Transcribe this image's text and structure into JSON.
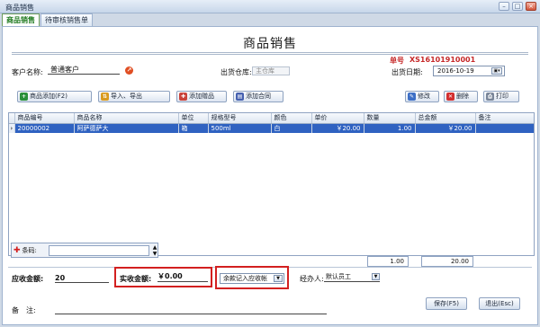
{
  "window": {
    "title": "商品销售",
    "buttons": {
      "minimize": "–",
      "maximize": "□",
      "close": "×"
    }
  },
  "tabs": [
    {
      "label": "商品销售",
      "active": true
    },
    {
      "label": "待审核销售单",
      "active": false
    }
  ],
  "form": {
    "title": "商品销售",
    "order_no_label": "单号",
    "order_no": "XS16101910001",
    "customer_label": "客户名称:",
    "customer_value": "普通客户",
    "warehouse_label": "出货仓库:",
    "warehouse_value": "主仓库",
    "date_label": "出货日期:",
    "date_value": "2016-10-19"
  },
  "toolbar": {
    "add_goods": "商品添加(F2)",
    "import_export": "导入、导出",
    "add_gift": "添加赠品",
    "add_contract": "添加合同",
    "edit": "修改",
    "delete": "删除",
    "print": "打印"
  },
  "grid": {
    "columns": [
      "商品编号",
      "商品名称",
      "单位",
      "规格型号",
      "颜色",
      "单价",
      "数量",
      "总金额",
      "备注"
    ],
    "rows": [
      {
        "code": "20000002",
        "name": "阿萨德萨大",
        "unit": "箱",
        "spec": "500ml",
        "color": "白",
        "price": "￥20.00",
        "qty": "1.00",
        "total": "￥20.00",
        "note": ""
      }
    ],
    "totals": {
      "qty": "1.00",
      "amount": "20.00"
    }
  },
  "barcode": {
    "label": "条码:",
    "value": ""
  },
  "footer": {
    "receivable_label": "应收金额:",
    "receivable_value": "20",
    "actual_label": "实收金额:",
    "actual_value": "￥0.00",
    "balance_option": "余款记入应收帐",
    "agent_label": "经办人:",
    "agent_value": "默认员工",
    "remark_label": "备　注:",
    "remark_value": "",
    "save": "保存(F5)",
    "exit": "退出(Esc)"
  },
  "colors": {
    "accent_red": "#d32020",
    "selection_blue": "#2f62c1",
    "order_no_red": "#c62828",
    "active_tab_green": "#1f7a1f"
  }
}
